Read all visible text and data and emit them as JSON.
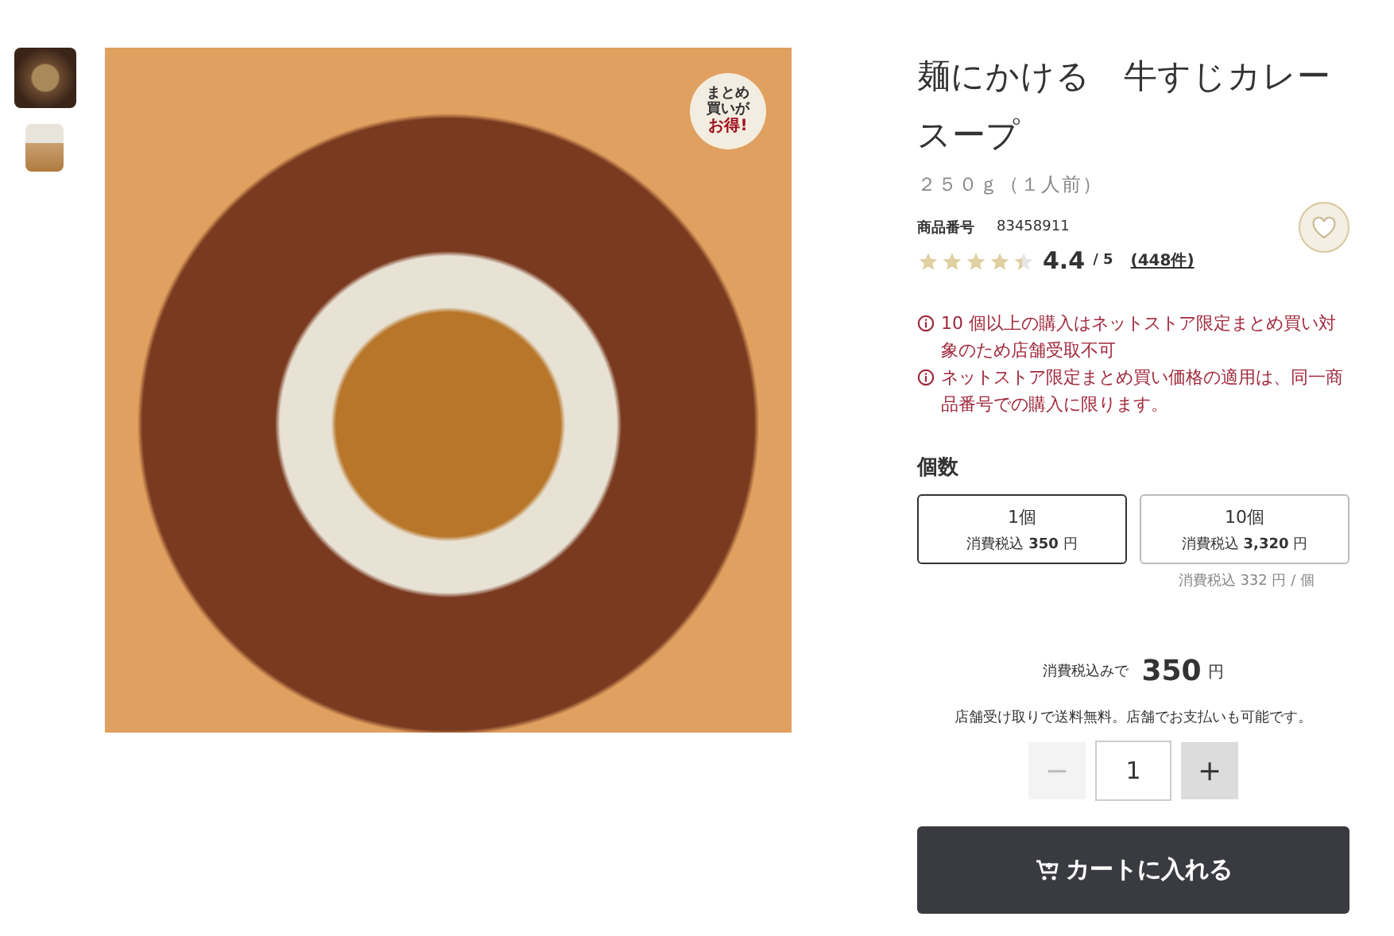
{
  "gallery": {
    "thumbnails": [
      {
        "selected": true
      },
      {
        "selected": false
      }
    ],
    "badge": [
      "まとめ",
      "買いが",
      "お得!"
    ]
  },
  "product": {
    "title": "麺にかける　牛すじカレースープ",
    "size": "２５０ｇ（１人前）",
    "code_label": "商品番号",
    "code": "83458911",
    "favorite": false,
    "stars": 4.4,
    "rating": "4.4",
    "rating_max": "/ 5",
    "reviews": "(448件)"
  },
  "notices": [
    "10 個以上の購入はネットストア限定まとめ買い対象のため店舗受取不可",
    "ネットストア限定まとめ買い価格の適用は、同一商品番号での購入に限ります。"
  ],
  "quantity": {
    "label": "個数",
    "options": [
      {
        "name": "1個",
        "price": "消費税込 **350** 円",
        "selected": true
      },
      {
        "name": "10個",
        "price": "消費税込 **3,320** 円",
        "selected": false
      }
    ],
    "unit_note": "消費税込 332 円 / 個"
  },
  "total": {
    "label": "消費税込みで",
    "amount": "350",
    "unit": "円"
  },
  "shipping_note": "店舗受け取りで送料無料。店舗でお支払いも可能です。",
  "stepper": {
    "minus": "−",
    "value": "1",
    "plus": "+",
    "minus_disabled": true
  },
  "cart_button": "カートに入れる"
}
